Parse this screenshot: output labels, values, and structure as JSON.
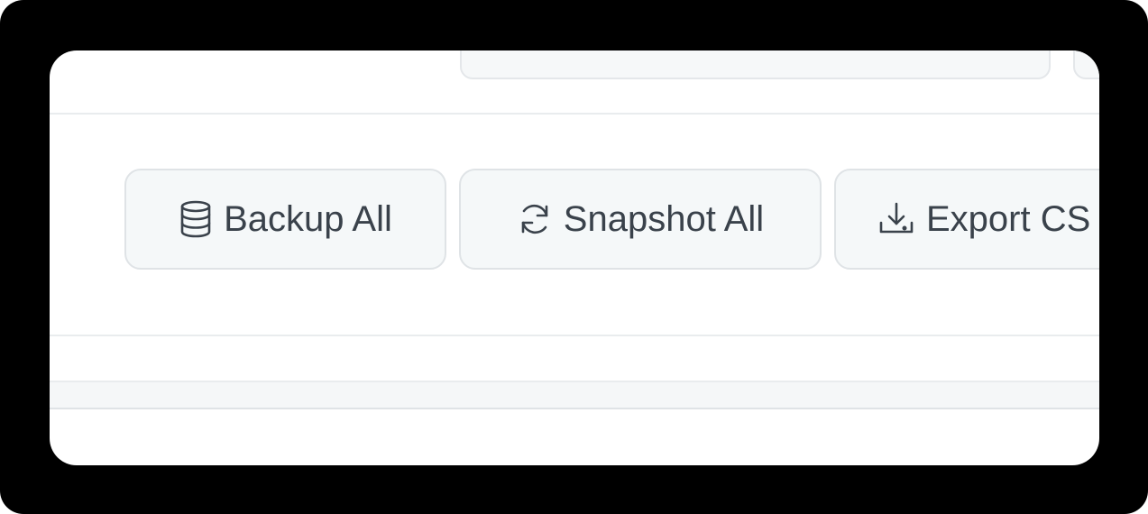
{
  "toolbar": {
    "backup_label": "Backup All",
    "snapshot_label": "Snapshot All",
    "export_label": "Export CS"
  },
  "icons": {
    "backup": "database-icon",
    "snapshot": "refresh-icon",
    "export": "download-icon"
  },
  "colors": {
    "button_bg": "#f5f8f9",
    "button_border": "#dfe3e6",
    "text": "#3a424b"
  }
}
